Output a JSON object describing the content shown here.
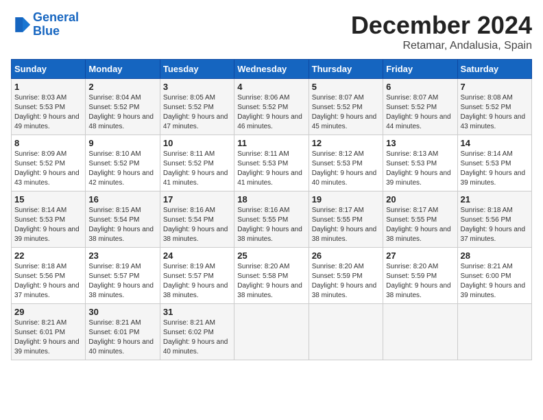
{
  "header": {
    "logo_line1": "General",
    "logo_line2": "Blue",
    "month": "December 2024",
    "location": "Retamar, Andalusia, Spain"
  },
  "weekdays": [
    "Sunday",
    "Monday",
    "Tuesday",
    "Wednesday",
    "Thursday",
    "Friday",
    "Saturday"
  ],
  "weeks": [
    [
      {
        "day": "1",
        "sunrise": "Sunrise: 8:03 AM",
        "sunset": "Sunset: 5:53 PM",
        "daylight": "Daylight: 9 hours and 49 minutes."
      },
      {
        "day": "2",
        "sunrise": "Sunrise: 8:04 AM",
        "sunset": "Sunset: 5:52 PM",
        "daylight": "Daylight: 9 hours and 48 minutes."
      },
      {
        "day": "3",
        "sunrise": "Sunrise: 8:05 AM",
        "sunset": "Sunset: 5:52 PM",
        "daylight": "Daylight: 9 hours and 47 minutes."
      },
      {
        "day": "4",
        "sunrise": "Sunrise: 8:06 AM",
        "sunset": "Sunset: 5:52 PM",
        "daylight": "Daylight: 9 hours and 46 minutes."
      },
      {
        "day": "5",
        "sunrise": "Sunrise: 8:07 AM",
        "sunset": "Sunset: 5:52 PM",
        "daylight": "Daylight: 9 hours and 45 minutes."
      },
      {
        "day": "6",
        "sunrise": "Sunrise: 8:07 AM",
        "sunset": "Sunset: 5:52 PM",
        "daylight": "Daylight: 9 hours and 44 minutes."
      },
      {
        "day": "7",
        "sunrise": "Sunrise: 8:08 AM",
        "sunset": "Sunset: 5:52 PM",
        "daylight": "Daylight: 9 hours and 43 minutes."
      }
    ],
    [
      {
        "day": "8",
        "sunrise": "Sunrise: 8:09 AM",
        "sunset": "Sunset: 5:52 PM",
        "daylight": "Daylight: 9 hours and 43 minutes."
      },
      {
        "day": "9",
        "sunrise": "Sunrise: 8:10 AM",
        "sunset": "Sunset: 5:52 PM",
        "daylight": "Daylight: 9 hours and 42 minutes."
      },
      {
        "day": "10",
        "sunrise": "Sunrise: 8:11 AM",
        "sunset": "Sunset: 5:52 PM",
        "daylight": "Daylight: 9 hours and 41 minutes."
      },
      {
        "day": "11",
        "sunrise": "Sunrise: 8:11 AM",
        "sunset": "Sunset: 5:53 PM",
        "daylight": "Daylight: 9 hours and 41 minutes."
      },
      {
        "day": "12",
        "sunrise": "Sunrise: 8:12 AM",
        "sunset": "Sunset: 5:53 PM",
        "daylight": "Daylight: 9 hours and 40 minutes."
      },
      {
        "day": "13",
        "sunrise": "Sunrise: 8:13 AM",
        "sunset": "Sunset: 5:53 PM",
        "daylight": "Daylight: 9 hours and 39 minutes."
      },
      {
        "day": "14",
        "sunrise": "Sunrise: 8:14 AM",
        "sunset": "Sunset: 5:53 PM",
        "daylight": "Daylight: 9 hours and 39 minutes."
      }
    ],
    [
      {
        "day": "15",
        "sunrise": "Sunrise: 8:14 AM",
        "sunset": "Sunset: 5:53 PM",
        "daylight": "Daylight: 9 hours and 39 minutes."
      },
      {
        "day": "16",
        "sunrise": "Sunrise: 8:15 AM",
        "sunset": "Sunset: 5:54 PM",
        "daylight": "Daylight: 9 hours and 38 minutes."
      },
      {
        "day": "17",
        "sunrise": "Sunrise: 8:16 AM",
        "sunset": "Sunset: 5:54 PM",
        "daylight": "Daylight: 9 hours and 38 minutes."
      },
      {
        "day": "18",
        "sunrise": "Sunrise: 8:16 AM",
        "sunset": "Sunset: 5:55 PM",
        "daylight": "Daylight: 9 hours and 38 minutes."
      },
      {
        "day": "19",
        "sunrise": "Sunrise: 8:17 AM",
        "sunset": "Sunset: 5:55 PM",
        "daylight": "Daylight: 9 hours and 38 minutes."
      },
      {
        "day": "20",
        "sunrise": "Sunrise: 8:17 AM",
        "sunset": "Sunset: 5:55 PM",
        "daylight": "Daylight: 9 hours and 38 minutes."
      },
      {
        "day": "21",
        "sunrise": "Sunrise: 8:18 AM",
        "sunset": "Sunset: 5:56 PM",
        "daylight": "Daylight: 9 hours and 37 minutes."
      }
    ],
    [
      {
        "day": "22",
        "sunrise": "Sunrise: 8:18 AM",
        "sunset": "Sunset: 5:56 PM",
        "daylight": "Daylight: 9 hours and 37 minutes."
      },
      {
        "day": "23",
        "sunrise": "Sunrise: 8:19 AM",
        "sunset": "Sunset: 5:57 PM",
        "daylight": "Daylight: 9 hours and 38 minutes."
      },
      {
        "day": "24",
        "sunrise": "Sunrise: 8:19 AM",
        "sunset": "Sunset: 5:57 PM",
        "daylight": "Daylight: 9 hours and 38 minutes."
      },
      {
        "day": "25",
        "sunrise": "Sunrise: 8:20 AM",
        "sunset": "Sunset: 5:58 PM",
        "daylight": "Daylight: 9 hours and 38 minutes."
      },
      {
        "day": "26",
        "sunrise": "Sunrise: 8:20 AM",
        "sunset": "Sunset: 5:59 PM",
        "daylight": "Daylight: 9 hours and 38 minutes."
      },
      {
        "day": "27",
        "sunrise": "Sunrise: 8:20 AM",
        "sunset": "Sunset: 5:59 PM",
        "daylight": "Daylight: 9 hours and 38 minutes."
      },
      {
        "day": "28",
        "sunrise": "Sunrise: 8:21 AM",
        "sunset": "Sunset: 6:00 PM",
        "daylight": "Daylight: 9 hours and 39 minutes."
      }
    ],
    [
      {
        "day": "29",
        "sunrise": "Sunrise: 8:21 AM",
        "sunset": "Sunset: 6:01 PM",
        "daylight": "Daylight: 9 hours and 39 minutes."
      },
      {
        "day": "30",
        "sunrise": "Sunrise: 8:21 AM",
        "sunset": "Sunset: 6:01 PM",
        "daylight": "Daylight: 9 hours and 40 minutes."
      },
      {
        "day": "31",
        "sunrise": "Sunrise: 8:21 AM",
        "sunset": "Sunset: 6:02 PM",
        "daylight": "Daylight: 9 hours and 40 minutes."
      },
      null,
      null,
      null,
      null
    ]
  ]
}
